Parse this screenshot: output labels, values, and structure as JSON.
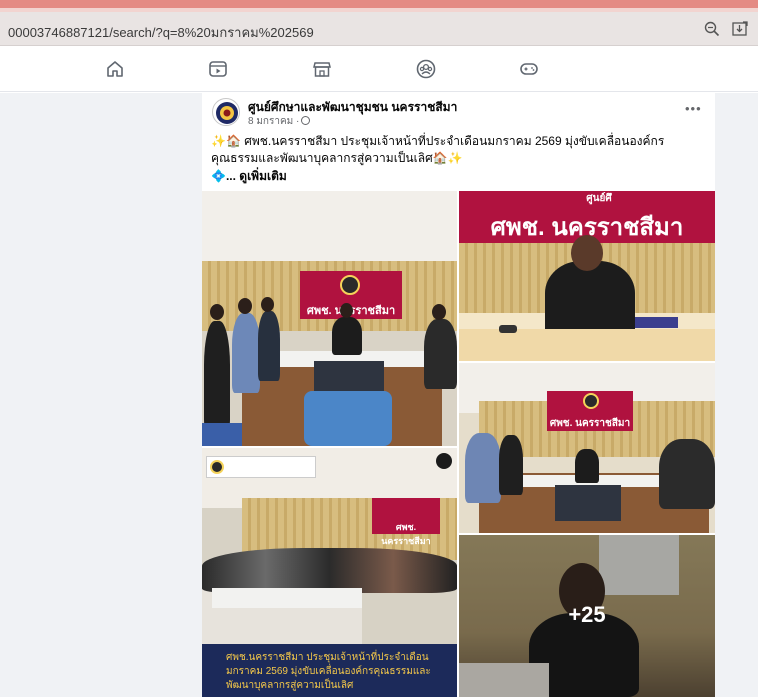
{
  "browser": {
    "url": "00003746887121/search/?q=8%20มกราคม%202569"
  },
  "icons": {
    "zoom": "zoom-icon",
    "download": "download-icon",
    "nav": [
      "home-icon",
      "video-icon",
      "marketplace-icon",
      "groups-icon",
      "gaming-icon"
    ]
  },
  "post": {
    "page_name": "ศูนย์ศึกษาและพัฒนาชุมชน นครราชสีมา",
    "date": "8 มกราคม ·",
    "more": "•••",
    "text": "✨🏠 ศพช.นครราชสีมา ประชุมเจ้าหน้าที่ประจำเดือนมกราคม 2569 มุ่งขับเคลื่อนองค์กรคุณธรรมและพัฒนาบุคลากรสู่ความเป็นเลิศ🏠✨",
    "see_more": "💠... ดูเพิ่มเติม"
  },
  "photos": {
    "banner_1": "ศพช. นครราชสีมา",
    "banner_2": "ศพช. นครราชสีมา",
    "banner_2_top": "ศูนย์ศึ",
    "banner_4": "ศพช. นครราชสีมา",
    "banner_3": "ศพช. นครราชสีมา",
    "caption": "ศพช.นครราชสีมา ประชุมเจ้าหน้าที่ประจำเดือนมกราคม 2569 มุ่งขับเคลื่อนองค์กรคุณธรรมและพัฒนาบุคลากรสู่ความเป็นเลิศ",
    "more_count": "+25"
  },
  "colors": {
    "banner": "#b0123f",
    "fb_bg": "#f0f2f5",
    "caption_bar": "#1c2a5a",
    "caption_text": "#f3c74a"
  }
}
